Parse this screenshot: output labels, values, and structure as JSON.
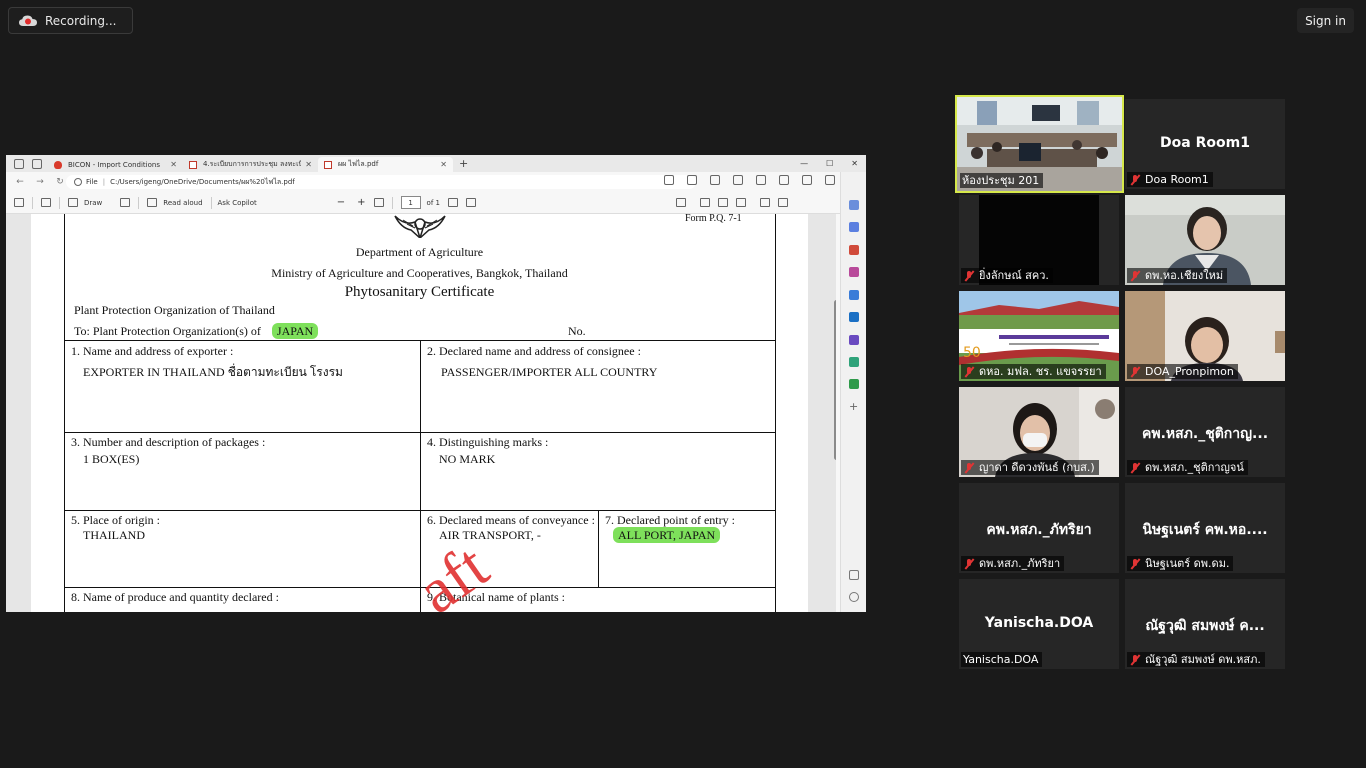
{
  "zoom": {
    "recording_label": "Recording...",
    "sign_in_label": "Sign in"
  },
  "browser": {
    "tabs": [
      {
        "title": "BICON - Import Conditions"
      },
      {
        "title": "4.ระเบียบการการประชุม ลงทะเบียนไม่"
      },
      {
        "title": "ผผ ไฟไล.pdf"
      }
    ],
    "new_tab_label": "+",
    "window_controls": [
      "—",
      "☐",
      "✕"
    ],
    "address": {
      "file_label": "File",
      "url": "C:/Users/igeng/OneDrive/Documents/ผผ%20ไฟไล.pdf"
    },
    "pdf_toolbar": {
      "draw_label": "Draw",
      "read_aloud_label": "Read aloud",
      "ask_copilot_label": "Ask Copilot",
      "zoom_out": "−",
      "zoom_in": "+",
      "page_current": "1",
      "page_total": "of 1"
    }
  },
  "document": {
    "form_no": "Form P.Q. 7-1",
    "department": "Department of Agriculture",
    "ministry": "Ministry of Agriculture and Cooperatives, Bangkok, Thailand",
    "title": "Phytosanitary Certificate",
    "ppo": "Plant Protection Organization of Thailand",
    "to_label": "To: Plant Protection Organization(s) of",
    "to_value": "JAPAN",
    "no_label": "No.",
    "field1_label": "1. Name and address of exporter :",
    "field1_value": "EXPORTER  IN THAILAND  ชื่อตามทะเบียน โรงรม",
    "field2_label": "2. Declared name and address of consignee :",
    "field2_value": "PASSENGER/IMPORTER ALL COUNTRY",
    "field3_label": "3. Number and description of packages :",
    "field3_value": "1 BOX(ES)",
    "field4_label": "4. Distinguishing marks :",
    "field4_value": "NO MARK",
    "field5_label": "5. Place of origin :",
    "field5_value": "THAILAND",
    "field6_label": "6. Declared means of conveyance :",
    "field6_value": "AIR TRANSPORT, -",
    "field7_label": "7. Declared point of entry :",
    "field7_value": "ALL PORT, JAPAN",
    "field8_label": "8. Name of produce and quantity declared :",
    "field9_label": "9. Botanical name of plants :",
    "watermark": "aft"
  },
  "participants": [
    {
      "id": "room201",
      "caption": "ห้องประชุม 201",
      "muted": false,
      "video": true,
      "active": true
    },
    {
      "id": "doaroom1",
      "display": "Doa Room1",
      "caption": "Doa Room1",
      "muted": true,
      "video": false
    },
    {
      "id": "yinglak",
      "caption": "ยิ่งลักษณ์ สคว.",
      "muted": true,
      "video": true
    },
    {
      "id": "chiangmai",
      "caption": "ดพ.หอ.เชียงใหม่",
      "muted": true,
      "video": true
    },
    {
      "id": "maefahluang",
      "caption": "ดหอ. มฟล. ชร. แขจรรยา",
      "muted": true,
      "video": true
    },
    {
      "id": "pronpimon",
      "caption": "DOA_Pronpimon",
      "muted": true,
      "video": true
    },
    {
      "id": "yada",
      "caption": "ญาดา ดีดวงพันธ์ (กบส.)",
      "muted": true,
      "video": true
    },
    {
      "id": "chutikan",
      "display": "คพ.หสภ._ชุติกาญ...",
      "caption": "ดพ.หสภ._ชุติกาญจน์",
      "muted": true,
      "video": false
    },
    {
      "id": "phattariya",
      "display": "คพ.หสภ._ภัทริยา",
      "caption": "ดพ.หสภ._ภัทริยา",
      "muted": true,
      "video": false
    },
    {
      "id": "nitthanet",
      "display": "นิษฐเนตร์ คพ.หอ....",
      "caption": "นิษฐเนตร์ ดพ.ดม.",
      "muted": true,
      "video": false
    },
    {
      "id": "yanischa",
      "display": "Yanischa.DOA",
      "caption": "Yanischa.DOA",
      "muted": false,
      "video": false
    },
    {
      "id": "nathawut",
      "display": "ณัฐวุฒิ สมพงษ์ ค...",
      "caption": "ณัฐวุฒิ สมพงษ์ ดพ.หสภ.",
      "muted": true,
      "video": false
    }
  ]
}
